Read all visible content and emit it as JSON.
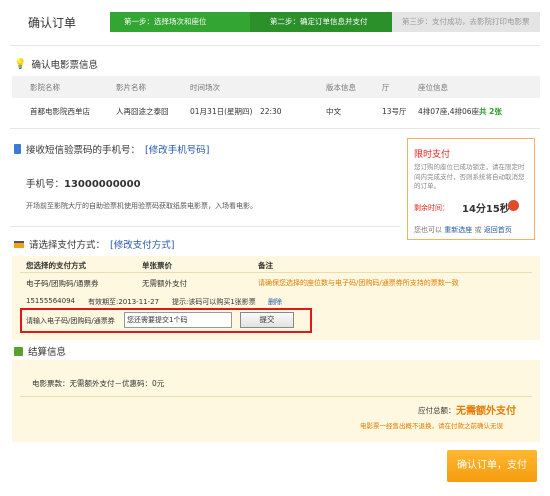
{
  "header": {
    "title": "确认订单"
  },
  "steps": [
    {
      "label": "第一步：选择场次和座位"
    },
    {
      "label": "第二步：确定订单信息并支付"
    },
    {
      "label": "第三步：支付成功，去影院打印电影票"
    }
  ],
  "ticket_info": {
    "section_title": "确认电影票信息",
    "columns": [
      "影院名称",
      "影片名称",
      "时间场次",
      "版本信息",
      "厅",
      "座位信息"
    ],
    "row": {
      "cinema": "首都电影院西单店",
      "movie": "人再囧途之泰囧",
      "time": "01月31日(星期四)　22:30",
      "version": "中文",
      "hall": "13号厅",
      "seats_prefix": "4排07座,4排06座",
      "seats_count": "共 2张"
    }
  },
  "sms": {
    "section_title": "接收短信验票码的手机号：",
    "edit_link": "[修改手机号码]",
    "phone_label": "手机号：",
    "phone": "13000000000",
    "note": "开场前至影院大厅的自助验票机使用验票码获取纸质电影票，入场看电影。"
  },
  "timer": {
    "title": "限时支付",
    "desc": "您订购的座位已成功锁定，请在限定时间内完成支付，否则系统将自动取消您的订单。",
    "remaining_label": "剩余时间：",
    "remaining": "14分15秒",
    "footer_prefix": "您也可以",
    "reselect": "重新选座",
    "or": "或",
    "back": "返回首页"
  },
  "payment": {
    "section_title": "请选择支付方式：",
    "edit_link": "[修改支付方式]",
    "columns": [
      "您选择的支付方式",
      "单张票价",
      "备注"
    ],
    "method": "电子码/团购码/通票券",
    "price": "无需额外支付",
    "remark": "请确保您选择的座位数与电子码/团购码/通票券所支持的票数一致",
    "code": "15155564094",
    "expiry": "有效期至:2013-11-27",
    "hint": "提示:该码可以购买1张影票",
    "delete": "删除",
    "input_label": "请输入电子码/团购码/通票券",
    "input_value": "您还需要提交1个码",
    "submit": "提交"
  },
  "settlement": {
    "section_title": "结算信息",
    "summary": "电影票款：无需额外支付－优惠码：0元",
    "total_label": "应付总额：",
    "total_value": "无需额外支付",
    "warning": "电影票一经售出概不退换，请在付款之前确认无误"
  },
  "confirm_button": "确认订单，支付",
  "colors": {
    "green": "#33a532",
    "orange": "#e87a00",
    "red": "#e0261b",
    "link": "#2458a8"
  }
}
